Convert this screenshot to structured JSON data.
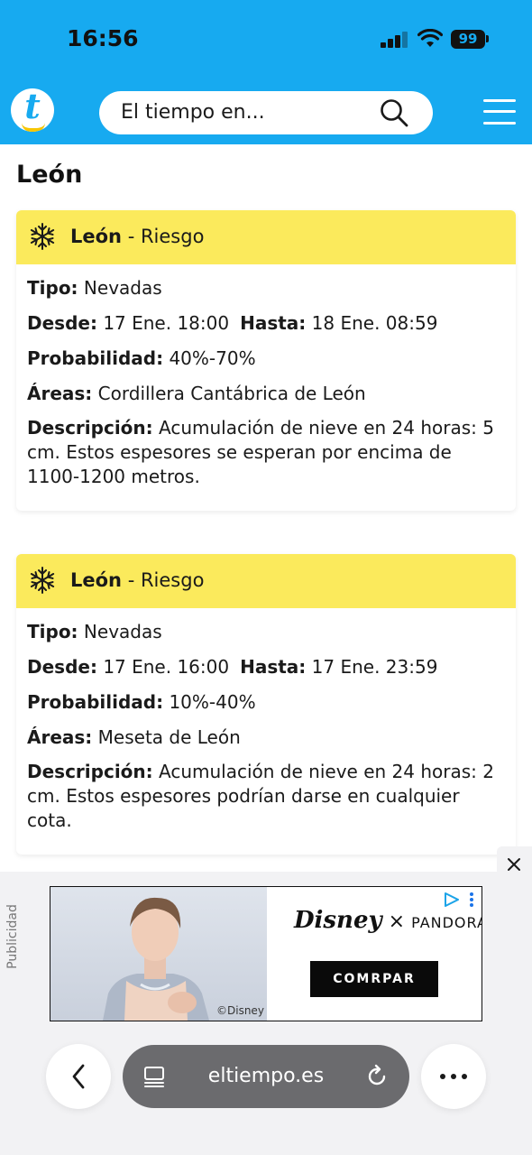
{
  "status_bar": {
    "time": "16:56",
    "battery": "99"
  },
  "header": {
    "logo_letter": "t",
    "search_placeholder": "El tiempo en...",
    "icons": [
      "search-icon",
      "hamburger-menu-icon"
    ]
  },
  "page": {
    "title": "León"
  },
  "alerts": [
    {
      "location": "León",
      "separator": " - ",
      "level": "Riesgo",
      "icon": "snowflake-icon",
      "tipo_label": "Tipo:",
      "tipo": "Nevadas",
      "desde_label": "Desde:",
      "desde": "17 Ene. 18:00",
      "hasta_label": "Hasta:",
      "hasta": "18 Ene. 08:59",
      "prob_label": "Probabilidad:",
      "prob": "40%-70%",
      "areas_label": "Áreas:",
      "areas": "Cordillera Cantábrica de León",
      "desc_label": "Descripción:",
      "desc": "Acumulación de nieve en 24 horas: 5 cm. Estos espesores se esperan por encima de 1100-1200 metros."
    },
    {
      "location": "León",
      "separator": " - ",
      "level": "Riesgo",
      "icon": "snowflake-icon",
      "tipo_label": "Tipo:",
      "tipo": "Nevadas",
      "desde_label": "Desde:",
      "desde": "17 Ene. 16:00",
      "hasta_label": "Hasta:",
      "hasta": "17 Ene. 23:59",
      "prob_label": "Probabilidad:",
      "prob": "10%-40%",
      "areas_label": "Áreas:",
      "areas": "Meseta de León",
      "desc_label": "Descripción:",
      "desc": "Acumulación de nieve en 24 horas: 2 cm. Estos espesores podrían darse en cualquier cota."
    }
  ],
  "ad": {
    "label": "Publicidad",
    "brand_disney": "Disney",
    "brand_x": "×",
    "brand_pandora": "PANDORA",
    "cta": "COMRPAR",
    "copyright": "©Disney"
  },
  "browser": {
    "url": "eltiempo.es"
  },
  "colors": {
    "header_blue": "#17aaf0",
    "alert_yellow": "#fbea5c",
    "logo_yellow": "#f7c600"
  }
}
